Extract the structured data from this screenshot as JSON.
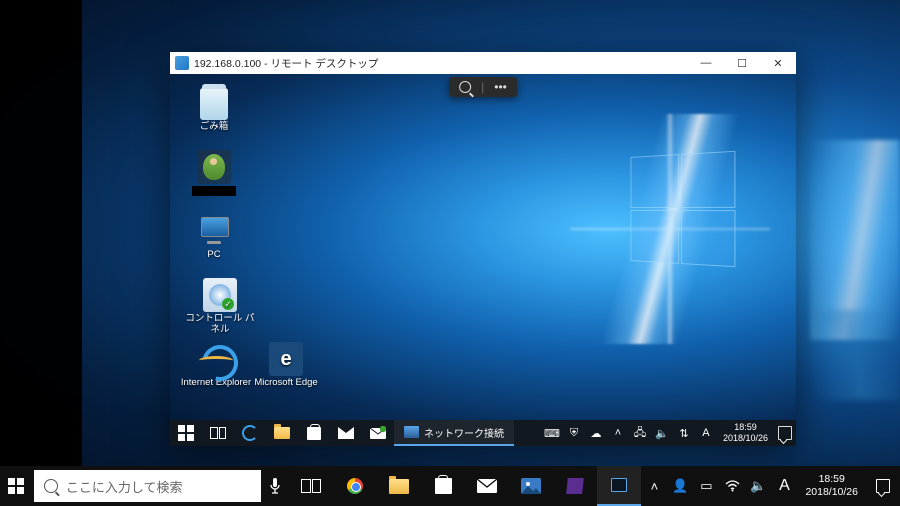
{
  "host": {
    "search_placeholder": "ここに入力して検索",
    "taskbar_apps": [
      "taskview",
      "chrome",
      "file-explorer",
      "store",
      "mail",
      "photos",
      "visual-studio",
      "remote-desktop"
    ],
    "tray": {
      "ime": "A",
      "time": "18:59",
      "date": "2018/10/26"
    }
  },
  "rdp": {
    "title": "192.168.0.100 - リモート デスクトップ",
    "conn_bar": {
      "zoom_icon": "zoom",
      "more": "•••"
    },
    "desktop_icons": [
      {
        "id": "recycle-bin",
        "label": "ごみ箱"
      },
      {
        "id": "user-folder",
        "label": ""
      },
      {
        "id": "pc",
        "label": "PC"
      },
      {
        "id": "control-panel",
        "label": "コントロール パネル"
      },
      {
        "id": "internet-explorer",
        "label": "Internet Explorer"
      },
      {
        "id": "microsoft-edge",
        "label": "Microsoft Edge"
      }
    ],
    "taskbar": {
      "active_app": "ネットワーク接続",
      "tray": {
        "ime": "A",
        "time": "18:59",
        "date": "2018/10/26"
      }
    }
  }
}
